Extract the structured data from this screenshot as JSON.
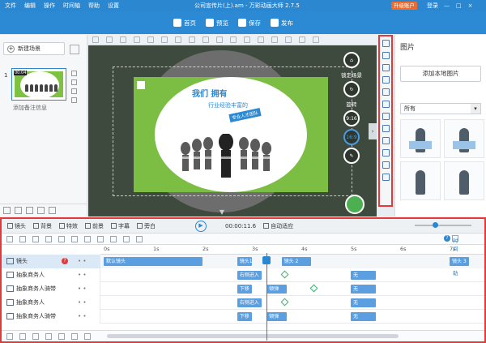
{
  "app": {
    "title": "公司宣传片(上).am - 万彩动画大师 2.7.5",
    "menu": [
      "文件",
      "编辑",
      "操作",
      "时间轴",
      "帮助",
      "设置"
    ],
    "upgrade": "升级账户",
    "login": "登录",
    "window_controls": [
      "—",
      "□",
      "×"
    ]
  },
  "toolbar": {
    "buttons": [
      {
        "label": "首页",
        "icon": "home-icon"
      },
      {
        "label": "预览",
        "icon": "preview-icon"
      },
      {
        "label": "保存",
        "icon": "save-icon"
      },
      {
        "label": "发布",
        "icon": "publish-icon"
      }
    ]
  },
  "scenes": {
    "new_scene": "新建场景",
    "items": [
      {
        "index": "1",
        "thumb_label": "00:04",
        "notes": "添加备注信息"
      }
    ]
  },
  "canvas": {
    "title_line1": "我们 拥有",
    "title_line2": "行业经验丰富的",
    "badge": "专业人才团队",
    "controls": {
      "lock_scene": "锁定场景",
      "rotate": "旋转",
      "ratio1": "9:16",
      "ratio2": "16:9"
    }
  },
  "right_panel": {
    "title": "图片",
    "add_button": "添加本地图片",
    "filter_selected": "所有"
  },
  "timeline": {
    "tabs": [
      "镜头",
      "背景",
      "特效",
      "前景",
      "字幕",
      "旁白"
    ],
    "timecode": "00:00:11.6",
    "auto_adapt": "自动适应",
    "help": "时间轴帮助",
    "ruler": [
      "0s",
      "1s",
      "2s",
      "3s",
      "4s",
      "5s",
      "6s",
      "7s"
    ],
    "rows": [
      {
        "name": "镜头",
        "warn": "?",
        "blocks": [
          {
            "label": "默认镜头",
            "start": 0,
            "end": 2.0
          },
          {
            "label": "镜头1",
            "start": 2.7,
            "end": 3.0
          },
          {
            "label": "镜头 2",
            "start": 3.6,
            "end": 4.2
          },
          {
            "label": "镜头 3",
            "start": 7.0,
            "end": 7.4
          }
        ]
      },
      {
        "name": "抽象商务人",
        "blocks": [
          {
            "label": "右侧进入",
            "start": 2.7,
            "end": 3.2
          },
          {
            "label": "无",
            "start": 5.0,
            "end": 5.5
          }
        ],
        "diamonds": [
          3.6
        ]
      },
      {
        "name": "抽象商务人骑带",
        "blocks": [
          {
            "label": "下移",
            "start": 2.7,
            "end": 3.0
          },
          {
            "label": "顿弹",
            "start": 3.3,
            "end": 3.7
          },
          {
            "label": "无",
            "start": 5.0,
            "end": 5.5
          }
        ],
        "diamonds": [
          4.2
        ]
      },
      {
        "name": "抽象商务人",
        "blocks": [
          {
            "label": "右侧进入",
            "start": 2.7,
            "end": 3.2
          },
          {
            "label": "无",
            "start": 5.0,
            "end": 5.5
          }
        ],
        "diamonds": [
          3.6
        ]
      },
      {
        "name": "抽象商务人骑带",
        "blocks": [
          {
            "label": "下移",
            "start": 2.7,
            "end": 3.0
          },
          {
            "label": "顿弹",
            "start": 3.3,
            "end": 3.7
          },
          {
            "label": "无",
            "start": 5.0,
            "end": 5.5
          }
        ],
        "diamonds": []
      }
    ]
  },
  "colors": {
    "brand": "#2a87d0",
    "upgrade": "#f06a2b",
    "highlight_border": "#e03a3a",
    "scene_green": "#7bbe43",
    "keyframe": "#3cb371"
  }
}
